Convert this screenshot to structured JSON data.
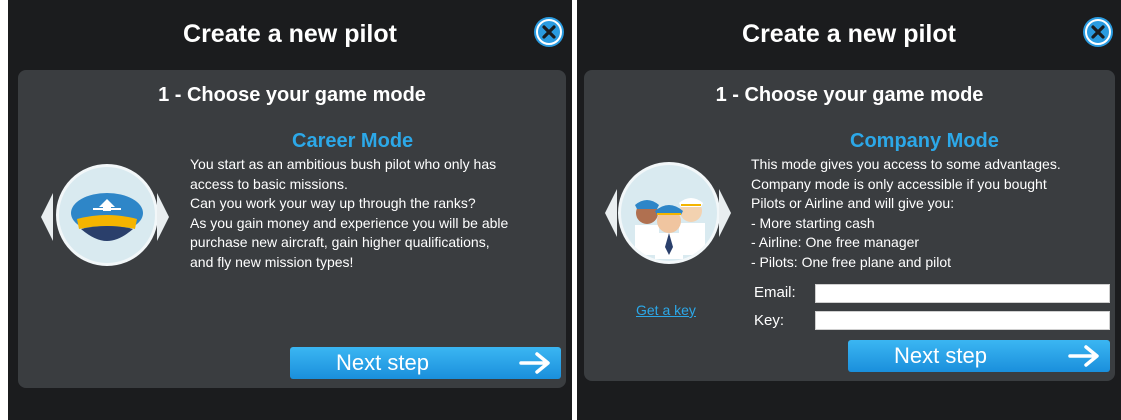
{
  "left_panel": {
    "window_title": "Create a new pilot",
    "step_title": "1 - Choose your game mode",
    "mode_title": "Career Mode",
    "description_lines": [
      "You start as an ambitious bush pilot who only has",
      "access to basic missions.",
      "Can you work your way up through the ranks?",
      "As you gain money and experience you will be able",
      "purchase new aircraft, gain higher qualifications,",
      "and fly new mission types!"
    ],
    "next_button": "Next step",
    "icon": "pilot-cap-icon"
  },
  "right_panel": {
    "window_title": "Create a new pilot",
    "step_title": "1 - Choose your game mode",
    "mode_title": "Company Mode",
    "description_lines": [
      "This mode gives you access to some advantages.",
      "Company mode is only accessible if you bought",
      "Pilots or Airline and will give you:",
      "- More starting cash",
      "- Airline: One free manager",
      "- Pilots: One free plane and pilot"
    ],
    "get_key_link": "Get a key",
    "email_label": "Email:",
    "email_value": "",
    "key_label": "Key:",
    "key_value": "",
    "next_button": "Next step",
    "icon": "pilot-group-icon"
  },
  "colors": {
    "accent": "#2ca8e8",
    "panel_bg": "#1b1c1e",
    "card_bg": "#3a3d40",
    "button_top": "#3bb6f2",
    "button_bottom": "#1a8fdc"
  }
}
